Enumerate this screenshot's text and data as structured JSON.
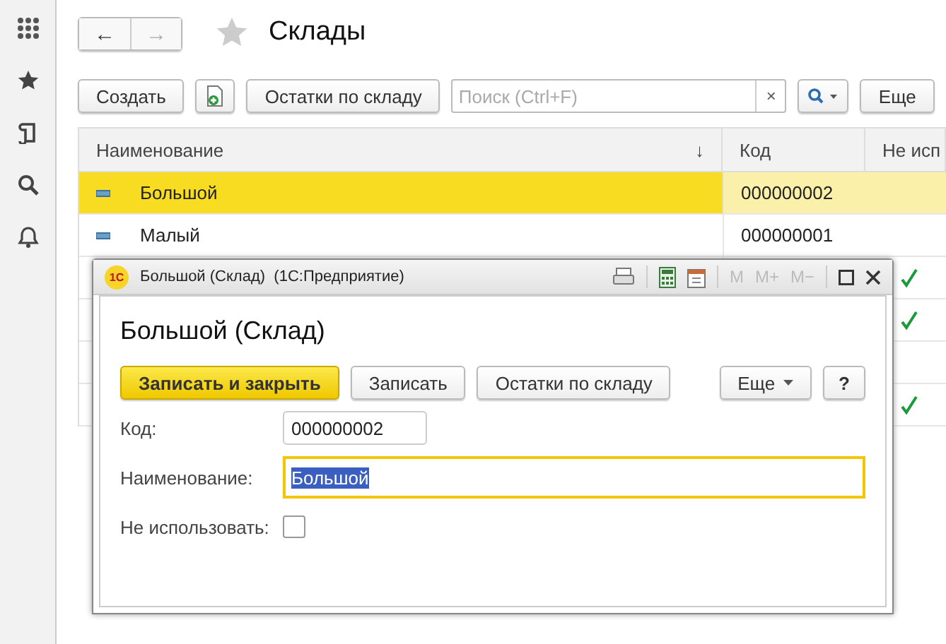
{
  "page": {
    "title": "Склады",
    "nav": [
      {
        "label": "←",
        "disabled": false
      },
      {
        "label": "→",
        "disabled": true
      }
    ]
  },
  "toolbar": {
    "create": "Создать",
    "stock": "Остатки по складу",
    "search": {
      "placeholder": "Поиск (Ctrl+F)",
      "clear": "×"
    },
    "more": "Еще"
  },
  "table": {
    "columns": [
      {
        "label": "Наименование",
        "sort": "↓"
      },
      {
        "label": "Код"
      },
      {
        "label": "Не исп"
      }
    ],
    "rows": [
      {
        "name": "Большой",
        "code": "000000002",
        "unused": false,
        "selected": true
      },
      {
        "name": "Малый",
        "code": "000000001",
        "unused": false,
        "selected": false
      },
      {
        "unused": true,
        "selected": false
      },
      {
        "unused": true,
        "selected": false
      },
      {
        "unused": false,
        "selected": false
      },
      {
        "unused": true,
        "selected": false
      }
    ]
  },
  "dialog": {
    "logo": "1С",
    "title": "Большой (Склад)  (1С:Предприятие)",
    "memory": [
      {
        "label": "M",
        "disabled": true
      },
      {
        "label": "M+",
        "disabled": true
      },
      {
        "label": "M−",
        "disabled": true
      }
    ],
    "heading": "Большой (Склад)",
    "buttons": [
      {
        "label": "Записать и закрыть",
        "kind": "primary"
      },
      {
        "label": "Записать",
        "kind": "plain"
      },
      {
        "label": "Остатки по складу",
        "kind": "plain"
      }
    ],
    "more": "Еще",
    "help": "?",
    "fields": [
      {
        "kind": "text",
        "label": "Код:",
        "value": "000000002",
        "focused": false
      },
      {
        "kind": "text",
        "label": "Наименование:",
        "value": "Большой",
        "focused": true
      },
      {
        "kind": "checkbox",
        "label": "Не использовать:",
        "checked": false
      }
    ]
  }
}
